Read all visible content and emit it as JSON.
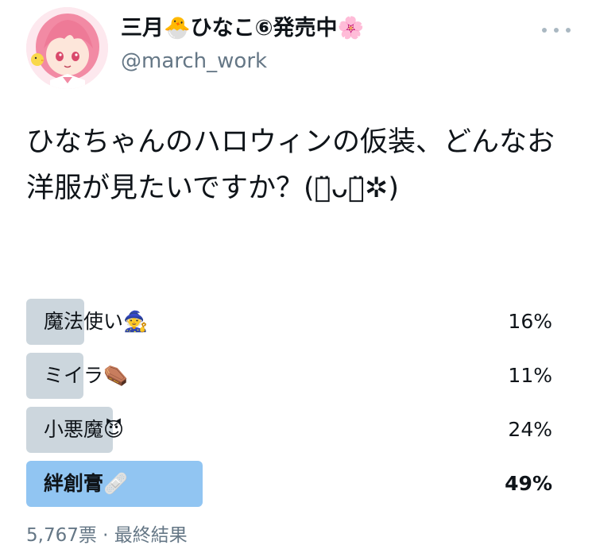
{
  "user": {
    "display_name": "三月🐣ひなこ⑥発売中🌸",
    "handle": "@march_work",
    "avatar_icon": "pink-haired-anime-girl-avatar"
  },
  "tweet": {
    "text": "ひなちゃんのハロウィンの仮装、どんなお洋服が見たいですか？(ｏ̈ᴗｏ̈✲)"
  },
  "poll": {
    "options": [
      {
        "label": "魔法使い🧙",
        "percent_text": "16%",
        "percent": 16,
        "winner": false
      },
      {
        "label": "ミイラ⚰️",
        "percent_text": "11%",
        "percent": 11,
        "winner": false
      },
      {
        "label": "小悪魔😈",
        "percent_text": "24%",
        "percent": 24,
        "winner": false
      },
      {
        "label": "絆創膏🩹",
        "percent_text": "49%",
        "percent": 49,
        "winner": true
      }
    ],
    "footer": "5,767票 · 最終結果"
  },
  "colors": {
    "bar_default": "#ccd6dd",
    "bar_winner": "#91c5f2",
    "secondary_text": "#657786"
  }
}
